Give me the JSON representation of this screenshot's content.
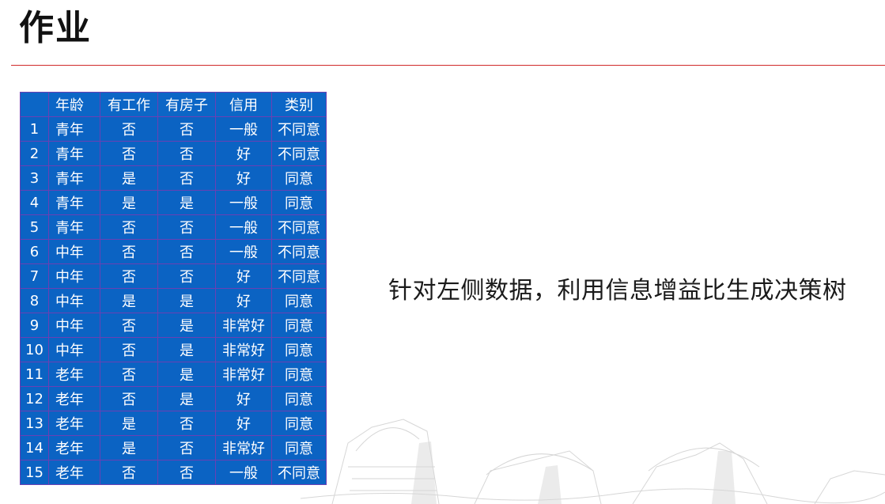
{
  "title": "作业",
  "table": {
    "headers": [
      "",
      "年龄",
      "有工作",
      "有房子",
      "信用",
      "类别"
    ],
    "rows": [
      [
        "1",
        "青年",
        "否",
        "否",
        "一般",
        "不同意"
      ],
      [
        "2",
        "青年",
        "否",
        "否",
        "好",
        "不同意"
      ],
      [
        "3",
        "青年",
        "是",
        "否",
        "好",
        "同意"
      ],
      [
        "4",
        "青年",
        "是",
        "是",
        "一般",
        "同意"
      ],
      [
        "5",
        "青年",
        "否",
        "否",
        "一般",
        "不同意"
      ],
      [
        "6",
        "中年",
        "否",
        "否",
        "一般",
        "不同意"
      ],
      [
        "7",
        "中年",
        "否",
        "否",
        "好",
        "不同意"
      ],
      [
        "8",
        "中年",
        "是",
        "是",
        "好",
        "同意"
      ],
      [
        "9",
        "中年",
        "否",
        "是",
        "非常好",
        "同意"
      ],
      [
        "10",
        "中年",
        "否",
        "是",
        "非常好",
        "同意"
      ],
      [
        "11",
        "老年",
        "否",
        "是",
        "非常好",
        "同意"
      ],
      [
        "12",
        "老年",
        "否",
        "是",
        "好",
        "同意"
      ],
      [
        "13",
        "老年",
        "是",
        "否",
        "好",
        "同意"
      ],
      [
        "14",
        "老年",
        "是",
        "否",
        "非常好",
        "同意"
      ],
      [
        "15",
        "老年",
        "否",
        "否",
        "一般",
        "不同意"
      ]
    ]
  },
  "instruction": "针对左侧数据，利用信息增益比生成决策树",
  "colors": {
    "table_bg": "#0b63c3",
    "table_border": "#6a40b4",
    "rule": "#d02a2a"
  }
}
